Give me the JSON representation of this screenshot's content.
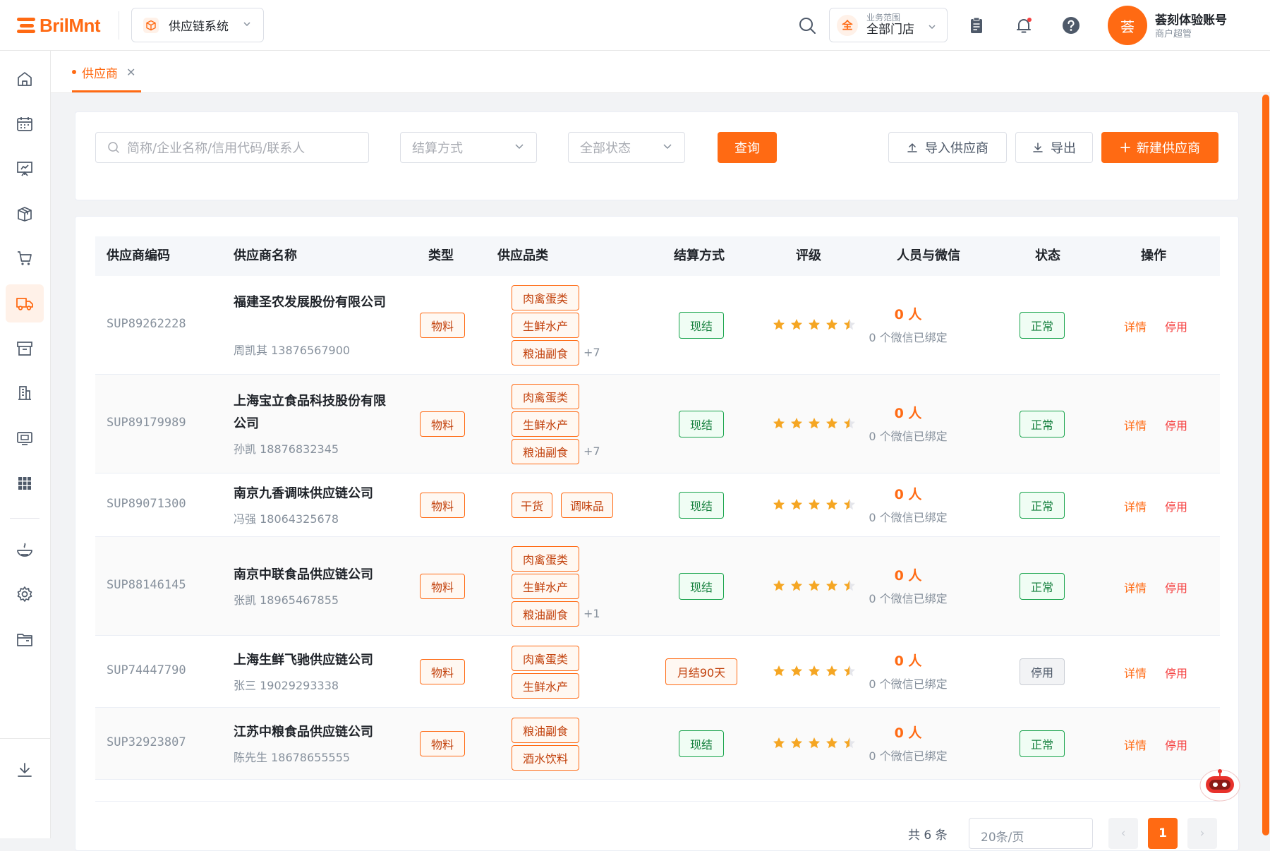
{
  "header": {
    "logo_text": "BrilMnt",
    "system_select": "供应链系统",
    "scope_badge": "全",
    "scope_label": "业务范围",
    "scope_value": "全部门店",
    "avatar_text": "荟",
    "user_name": "荟刻体验账号",
    "user_role": "商户超管"
  },
  "tabs": [
    {
      "label": "供应商"
    }
  ],
  "filters": {
    "search_placeholder": "简称/企业名称/信用代码/联系人",
    "settlement_placeholder": "结算方式",
    "status_placeholder": "全部状态",
    "query_label": "查询",
    "import_label": "导入供应商",
    "export_label": "导出",
    "new_label": "新建供应商"
  },
  "table": {
    "columns": [
      "供应商编码",
      "供应商名称",
      "类型",
      "供应品类",
      "结算方式",
      "评级",
      "人员与微信",
      "状态",
      "操作"
    ],
    "rows": [
      {
        "code": "SUP89262228",
        "name": "福建圣农发展股份有限公司",
        "contact": "周凯其 13876567900",
        "type": "物料",
        "categories": [
          "肉禽蛋类",
          "生鲜水产",
          "粮油副食"
        ],
        "more": "+7",
        "settlement": "现结",
        "rating": 4.5,
        "people": "0 人",
        "wechat": "0 个微信已绑定",
        "status": "正常",
        "action_detail": "详情",
        "action_stop": "停用"
      },
      {
        "code": "SUP89179989",
        "name": "上海宝立食品科技股份有限公司",
        "contact": "孙凯 18876832345",
        "type": "物料",
        "categories": [
          "肉禽蛋类",
          "生鲜水产",
          "粮油副食"
        ],
        "more": "+7",
        "settlement": "现结",
        "rating": 4.5,
        "people": "0 人",
        "wechat": "0 个微信已绑定",
        "status": "正常",
        "action_detail": "详情",
        "action_stop": "停用"
      },
      {
        "code": "SUP89071300",
        "name": "南京九香调味供应链公司",
        "contact": "冯强 18064325678",
        "type": "物料",
        "categories": [
          "干货",
          "调味品"
        ],
        "more": "",
        "settlement": "现结",
        "rating": 4.5,
        "people": "0 人",
        "wechat": "0 个微信已绑定",
        "status": "正常",
        "action_detail": "详情",
        "action_stop": "停用"
      },
      {
        "code": "SUP88146145",
        "name": "南京中联食品供应链公司",
        "contact": "张凯 18965467855",
        "type": "物料",
        "categories": [
          "肉禽蛋类",
          "生鲜水产",
          "粮油副食"
        ],
        "more": "+1",
        "settlement": "现结",
        "rating": 4.5,
        "people": "0 人",
        "wechat": "0 个微信已绑定",
        "status": "正常",
        "action_detail": "详情",
        "action_stop": "停用"
      },
      {
        "code": "SUP74447790",
        "name": "上海生鲜飞驰供应链公司",
        "contact": "张三 19029293338",
        "type": "物料",
        "categories": [
          "肉禽蛋类",
          "生鲜水产"
        ],
        "more": "",
        "settlement": "月结90天",
        "rating": 4.5,
        "people": "0 人",
        "wechat": "0 个微信已绑定",
        "status": "停用",
        "action_detail": "详情",
        "action_stop": "停用"
      },
      {
        "code": "SUP32923807",
        "name": "江苏中粮食品供应链公司",
        "contact": "陈先生 18678655555",
        "type": "物料",
        "categories": [
          "粮油副食",
          "酒水饮料"
        ],
        "more": "",
        "settlement": "现结",
        "rating": 4.5,
        "people": "0 人",
        "wechat": "0 个微信已绑定",
        "status": "正常",
        "action_detail": "详情",
        "action_stop": "停用"
      }
    ]
  },
  "pagination": {
    "total": "共 6 条",
    "page_size": "20条/页",
    "current": "1"
  },
  "colors": {
    "accent": "#ff6a13",
    "success": "#16a34a",
    "danger": "#f53f3f",
    "star": "#f5a623"
  },
  "icons": {
    "nav": [
      "home-icon",
      "calendar-icon",
      "board-icon",
      "package-icon",
      "cart-icon",
      "truck-icon",
      "archive-icon",
      "building-icon",
      "monitor-icon",
      "grid-icon",
      "dish-icon",
      "gear-icon",
      "folder-icon",
      "download-icon"
    ]
  }
}
